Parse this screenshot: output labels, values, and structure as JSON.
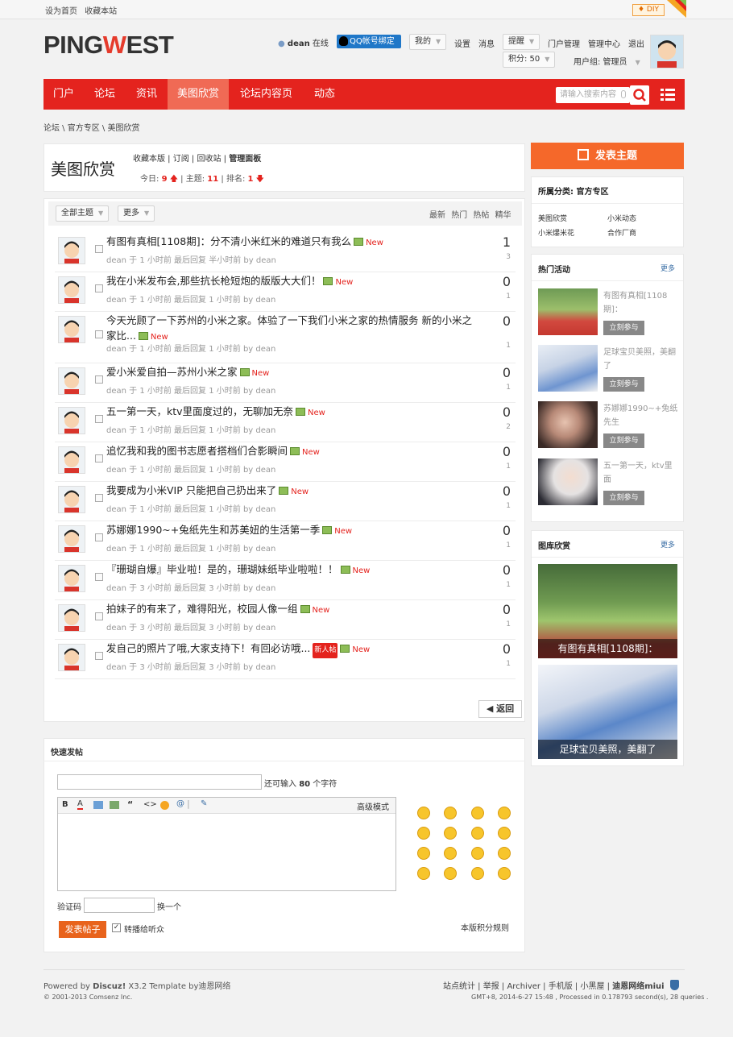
{
  "topbar": {
    "set_home": "设为首页",
    "bookmark": "收藏本站",
    "diy": "DIY"
  },
  "header": {
    "logo_pre": "PING",
    "logo_accent": "W",
    "logo_post": "EST",
    "username": "dean",
    "online": "在线",
    "qq_bind": "QQ帐号绑定",
    "my_menu": "我的",
    "settings": "设置",
    "messages": "消息",
    "remind": "提醒",
    "portal_admin": "门户管理",
    "admin_center": "管理中心",
    "logout": "退出",
    "points": "积分: 50",
    "usergroup": "用户组: 管理员"
  },
  "nav": {
    "items": [
      "门户",
      "论坛",
      "资讯",
      "美图欣赏",
      "论坛内容页",
      "动态"
    ],
    "active": "美图欣赏",
    "search_placeholder": "请输入搜索内容"
  },
  "breadcrumb": [
    "论坛",
    "官方专区",
    "美图欣赏"
  ],
  "forum": {
    "title": "美图欣赏",
    "links": [
      "收藏本版",
      "订阅",
      "回收站",
      "管理面板"
    ],
    "today_label": "今日:",
    "today": "9",
    "threads_label": "主题:",
    "threads": "11",
    "rank_label": "排名:",
    "rank": "1"
  },
  "list": {
    "filter_all": "全部主题",
    "filter_more": "更多",
    "sort": [
      "最新",
      "热门",
      "热帖",
      "精华"
    ],
    "threads": [
      {
        "title": "有图有真相[1108期]：分不清小米红米的难道只有我么",
        "meta": "dean 于 1 小时前 最后回复 半小时前 by dean",
        "replies": "1",
        "views": "3",
        "badge": ""
      },
      {
        "title": "我在小米发布会,那些抗长枪短炮的版版大大们！",
        "meta": "dean 于 1 小时前 最后回复 1 小时前 by dean",
        "replies": "0",
        "views": "1",
        "badge": ""
      },
      {
        "title": "今天光顾了一下苏州的小米之家。体验了一下我们小米之家的热情服务 新的小米之家比...",
        "meta": "dean 于 1 小时前 最后回复 1 小时前 by dean",
        "replies": "0",
        "views": "1",
        "badge": ""
      },
      {
        "title": "爱小米爱自拍—苏州小米之家",
        "meta": "dean 于 1 小时前 最后回复 1 小时前 by dean",
        "replies": "0",
        "views": "1",
        "badge": ""
      },
      {
        "title": "五一第一天，ktv里面度过的，无聊加无奈",
        "meta": "dean 于 1 小时前 最后回复 1 小时前 by dean",
        "replies": "0",
        "views": "2",
        "badge": ""
      },
      {
        "title": "追忆我和我的图书志愿者搭档们合影瞬间",
        "meta": "dean 于 1 小时前 最后回复 1 小时前 by dean",
        "replies": "0",
        "views": "1",
        "badge": ""
      },
      {
        "title": "我要成为小米VIP 只能把自己扔出来了",
        "meta": "dean 于 1 小时前 最后回复 1 小时前 by dean",
        "replies": "0",
        "views": "1",
        "badge": ""
      },
      {
        "title": "苏娜娜1990~+兔纸先生和苏美妞的生活第一季",
        "meta": "dean 于 1 小时前 最后回复 1 小时前 by dean",
        "replies": "0",
        "views": "1",
        "badge": ""
      },
      {
        "title": "『珊瑚自爆』毕业啦！是的，珊瑚妹纸毕业啦啦！！",
        "meta": "dean 于 3 小时前 最后回复 3 小时前 by dean",
        "replies": "0",
        "views": "1",
        "badge": ""
      },
      {
        "title": "拍妹子的有来了，难得阳光，校园人像一组",
        "meta": "dean 于 3 小时前 最后回复 3 小时前 by dean",
        "replies": "0",
        "views": "1",
        "badge": ""
      },
      {
        "title": "发自己的照片了哦,大家支持下！有回必访哦...",
        "meta": "dean 于 3 小时前 最后回复 3 小时前 by dean",
        "replies": "0",
        "views": "1",
        "badge": "新人帖"
      }
    ],
    "new_label": "New",
    "back": "返回"
  },
  "quickpost": {
    "title": "快速发帖",
    "remaining_pre": "还可输入",
    "remaining": "80",
    "remaining_post": "个字符",
    "advanced": "高级模式",
    "captcha": "验证码",
    "change": "换一个",
    "submit": "发表帖子",
    "share": "转播给听众",
    "rules": "本版积分规则"
  },
  "sidebar": {
    "post_button": "发表主题",
    "category_title": "所属分类: 官方专区",
    "categories": [
      "美图欣赏",
      "小米动态",
      "小米爆米花",
      "合作厂商"
    ],
    "hot_title": "热门活动",
    "more": "更多",
    "join": "立刻参与",
    "activities": [
      "有图有真相[1108期]：",
      "足球宝贝美照，美翻了",
      "苏娜娜1990~+兔纸先生",
      "五一第一天，ktv里面"
    ],
    "gallery_title": "图库欣赏",
    "gallery": [
      "有图有真相[1108期]：",
      "足球宝贝美照，美翻了"
    ]
  },
  "footer": {
    "powered_pre": "Powered by ",
    "powered_brand": "Discuz!",
    "powered_post": " X3.2  Template by迪恩网络",
    "copyright": "© 2001-2013 Comsenz Inc.",
    "links": [
      "站点统计",
      "举报",
      "Archiver",
      "手机版",
      "小黑屋",
      "迪恩网络miui"
    ],
    "stats": "GMT+8, 2014-6-27 15:48 , Processed in 0.178793 second(s), 28 queries ."
  },
  "colors": {
    "brand_red": "#e4231e",
    "nav_active": "#f06a55",
    "post_orange": "#f5682a"
  }
}
